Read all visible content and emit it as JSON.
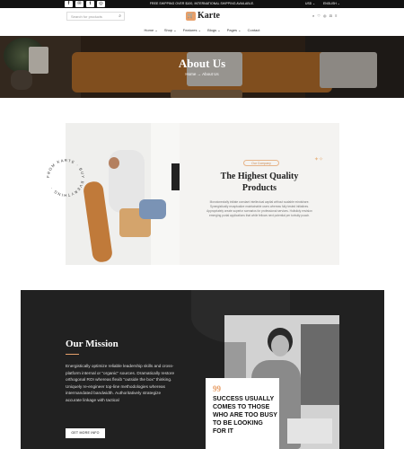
{
  "topbar": {
    "social_icons": [
      "f",
      "✉",
      "t",
      "◎"
    ],
    "promo": "FREE SHIPPING OVER $100, INTERNATIONAL SHIPPING AVAILABLE.",
    "currency": "USD ⌄",
    "language": "ENGLISH ⌄"
  },
  "header": {
    "search_placeholder": "Search for products",
    "search_icon": "⌕",
    "logo_mark": "🛒",
    "logo_text": "Karte",
    "icons": "⌕ ♡ ◎ ⊡ ≡"
  },
  "nav": [
    "Home ⌄",
    "Shop ⌄",
    "Features ⌄",
    "Blogs ⌄",
    "Pages ⌄",
    "Contact"
  ],
  "hero": {
    "title": "About Us",
    "breadcrumb_home": "Home",
    "breadcrumb_sep": "→",
    "breadcrumb_current": "About Us"
  },
  "circle_text": "FROM KARTE · BUY EVERYTHING ·",
  "quality": {
    "badge": "Our Company",
    "title_line1": "The Highest Quality",
    "title_line2": "Products",
    "body": "Monotonectally initiate constant intellectual capital without scalable mindshare. Synergistically recaptualize maintainable users whereas fully tested initiatives. Appropriately create superior scenarios for professional services. Holisticly envision emerging portal applications that while fellows next potential per turbulty poach."
  },
  "mission": {
    "title": "Our Mission",
    "body": "Energistically optimize reliable leadership skills and cross-platform internal or \"organic\" sources. Dramatically restore orthogonal ROI whereas flexib \"outside the box\" thinking. Uniquely re-engineer top-line methodologies whereas intermandated bandwidth. Authoritatively strategize accurate linkage with tactical",
    "button": "GET MORE INFO"
  },
  "quote": {
    "mark": "99",
    "text": "SUCCESS USUALLY COMES TO THOSE WHO ARE TOO BUSY TO BE LOOKING FOR IT"
  }
}
